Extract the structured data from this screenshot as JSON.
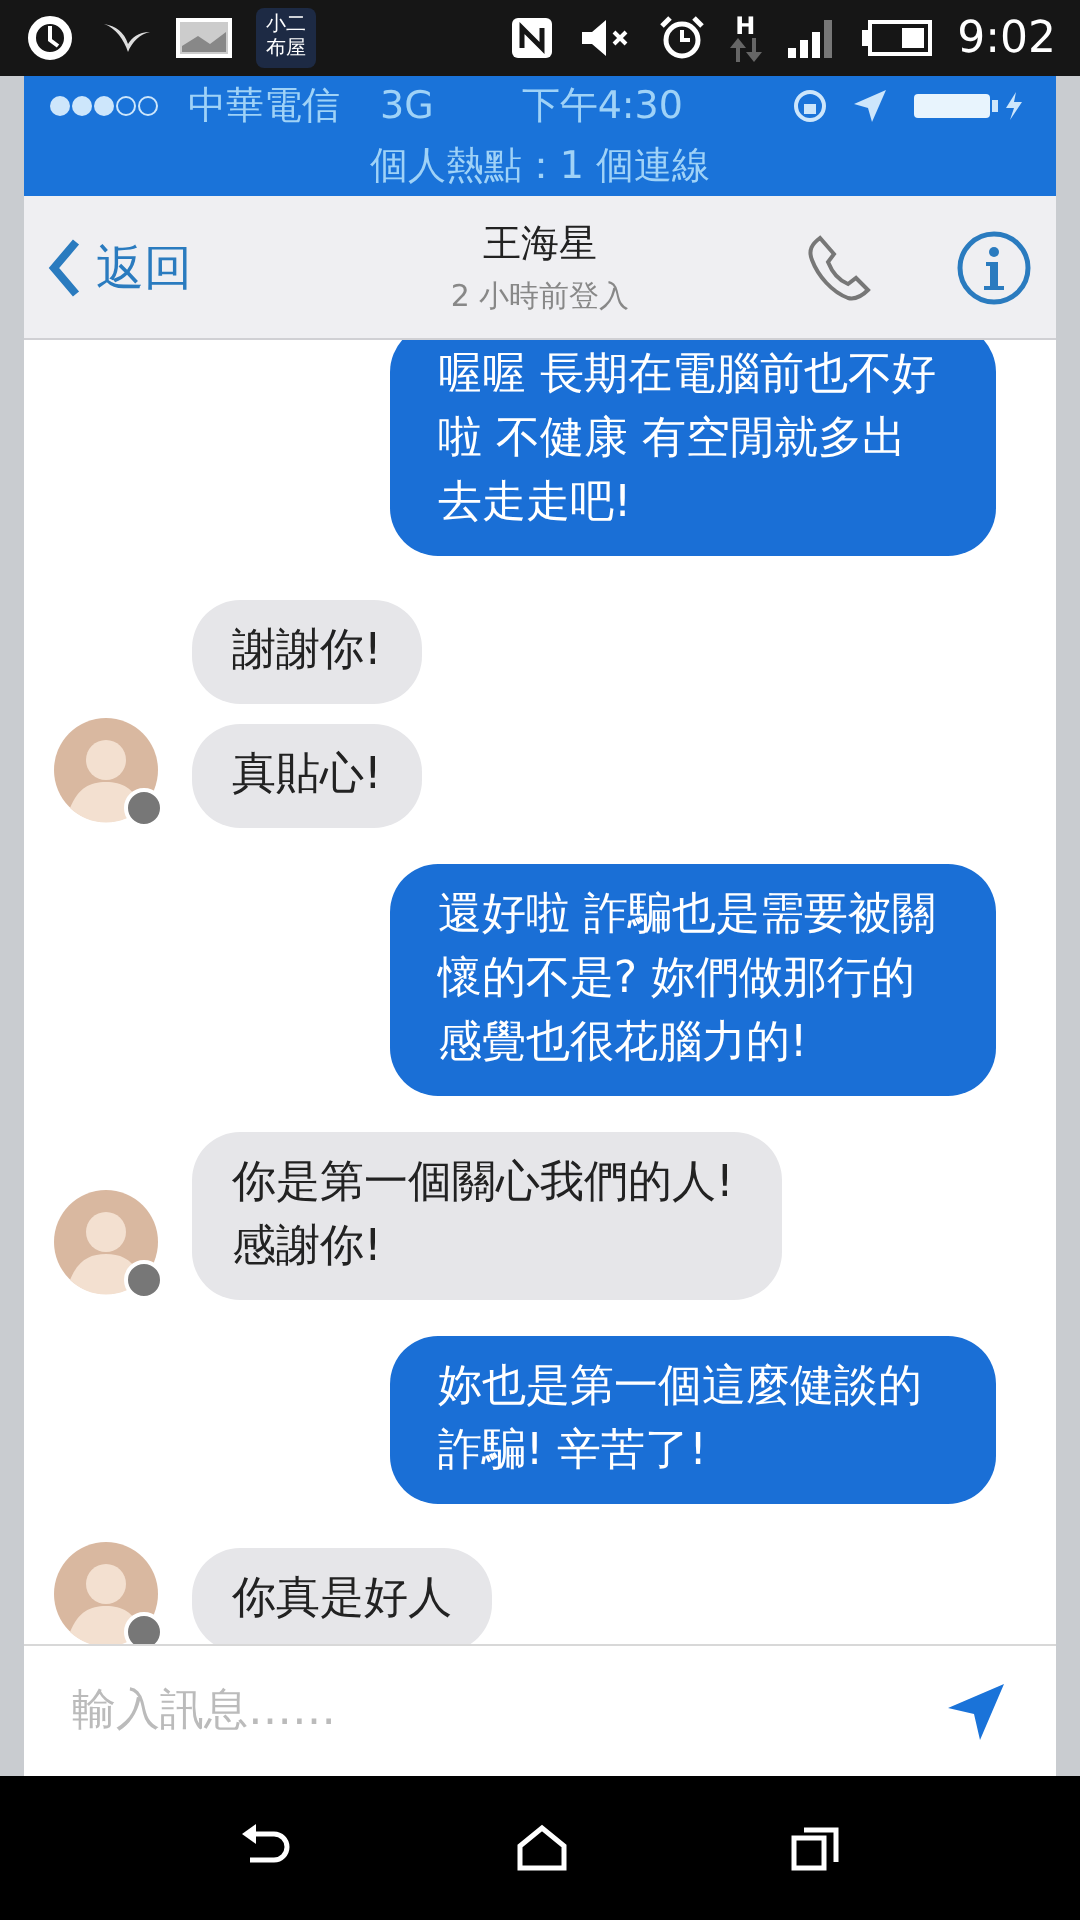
{
  "android_status": {
    "app_icon_text": [
      "小二",
      "布屋"
    ],
    "time": "9:02",
    "network_type": "H"
  },
  "ios_status": {
    "carrier": "中華電信",
    "network": "3G",
    "time": "下午4:30",
    "hotspot": "個人熱點：1 個連線"
  },
  "header": {
    "back": "返回",
    "contact": "王海星",
    "last_seen": "2 小時前登入"
  },
  "messages": [
    {
      "kind": "outgoing",
      "text": "喔喔 長期在電腦前也不好啦 不健康 有空閒就多出去走走吧!"
    },
    {
      "kind": "incoming",
      "avatar": false,
      "text": "謝謝你!"
    },
    {
      "kind": "incoming",
      "avatar": true,
      "text": "真貼心!"
    },
    {
      "kind": "outgoing",
      "text": "還好啦 詐騙也是需要被關懷的不是? 妳們做那行的感覺也很花腦力的!"
    },
    {
      "kind": "incoming",
      "avatar": true,
      "text": "你是第一個關心我們的人! 感謝你!"
    },
    {
      "kind": "outgoing",
      "text": "妳也是第一個這麼健談的詐騙! 辛苦了!"
    },
    {
      "kind": "incoming",
      "avatar": true,
      "text": "你真是好人"
    }
  ],
  "composer": {
    "placeholder": "輸入訊息……"
  }
}
